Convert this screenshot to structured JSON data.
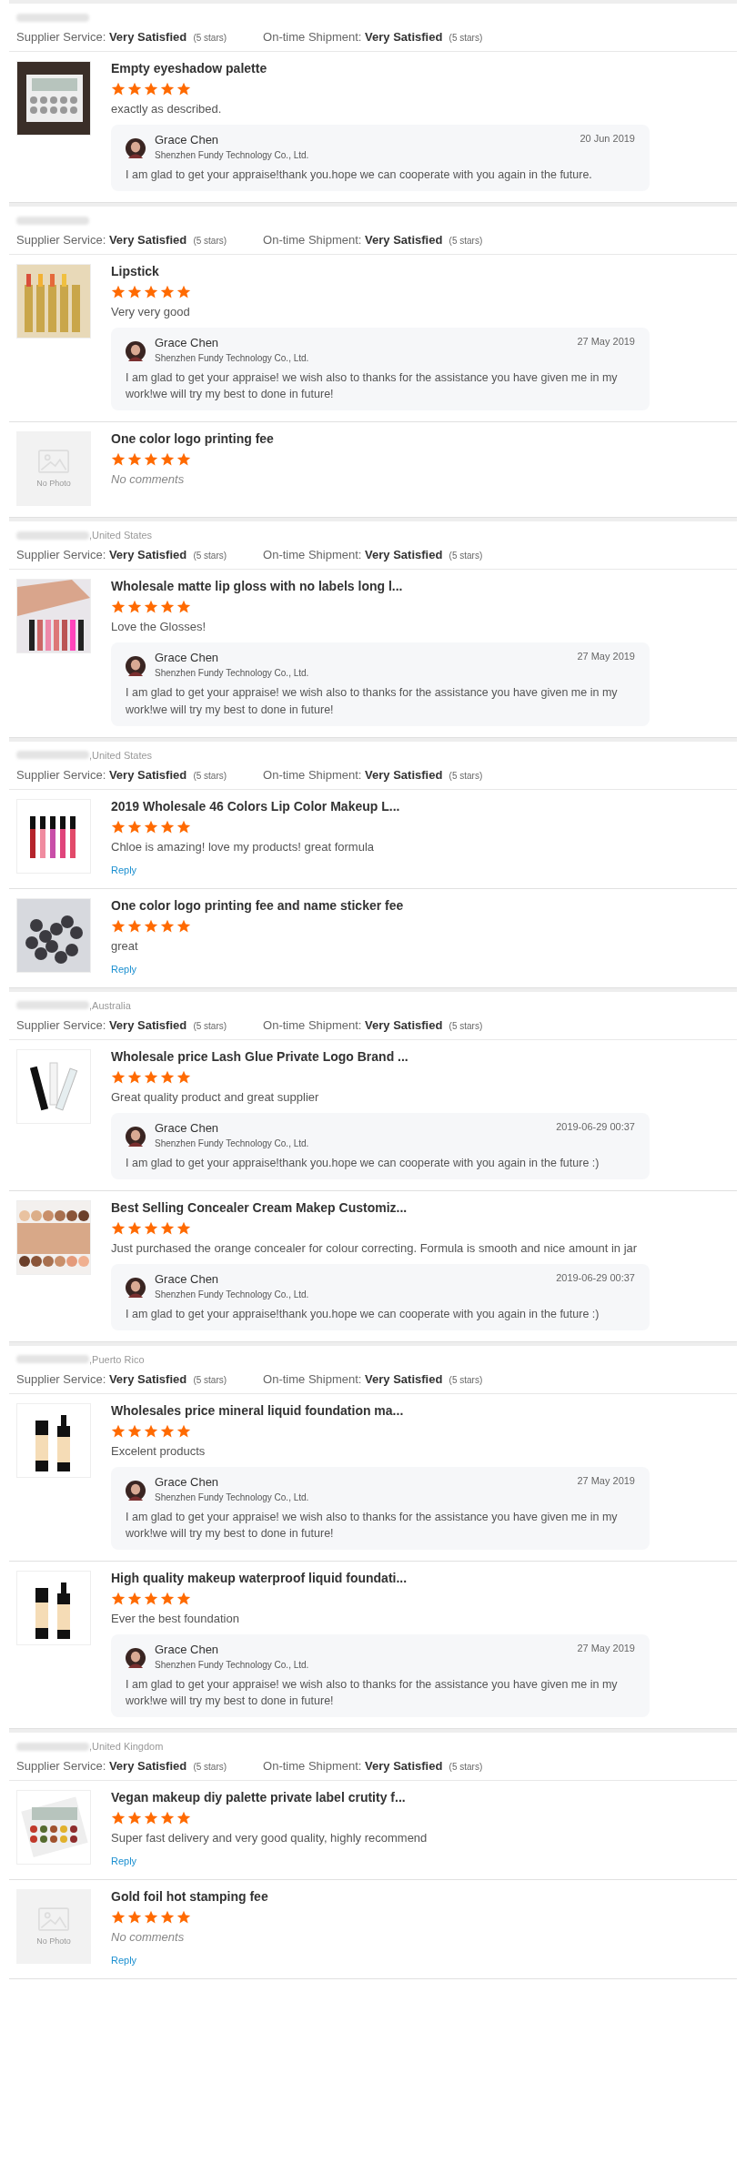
{
  "sections": [
    {
      "ratings": [
        {
          "label": "Supplier Service:",
          "value": "Very Satisfied",
          "note": "(5 stars)"
        },
        {
          "label": "On-time Shipment:",
          "value": "Very Satisfied",
          "note": "(5 stars)"
        }
      ],
      "items": [
        {
          "title": "Empty eyeshadow palette",
          "stars": 5,
          "comment": "exactly as described.",
          "comment_empty": false,
          "reply": {
            "name": "Grace Chen",
            "company": "Shenzhen Fundy Technology Co., Ltd.",
            "date": "20 Jun 2019",
            "text": "I am glad to get your appraise!thank you.hope we can cooperate with you again in the future."
          }
        }
      ]
    },
    {
      "ratings": [
        {
          "label": "Supplier Service:",
          "value": "Very Satisfied",
          "note": "(5 stars)"
        },
        {
          "label": "On-time Shipment:",
          "value": "Very Satisfied",
          "note": "(5 stars)"
        }
      ],
      "items": [
        {
          "title": "Lipstick",
          "stars": 5,
          "comment": "Very very good",
          "comment_empty": false,
          "reply": {
            "name": "Grace Chen",
            "company": "Shenzhen Fundy Technology Co., Ltd.",
            "date": "27 May 2019",
            "text": "I am glad to get your appraise! we wish also to thanks for the assistance you have given me in my work!we will try my best to done in future!"
          }
        },
        {
          "image": {
            "kind": "placeholder",
            "label": "No Photo"
          },
          "title": "One color logo printing fee",
          "stars": 5,
          "comment": "No comments",
          "comment_empty": true
        }
      ]
    },
    {
      "location": ",United States",
      "ratings": [
        {
          "label": "Supplier Service:",
          "value": "Very Satisfied",
          "note": "(5 stars)"
        },
        {
          "label": "On-time Shipment:",
          "value": "Very Satisfied",
          "note": "(5 stars)"
        }
      ],
      "items": [
        {
          "title": "Wholesale matte lip gloss with no labels long l...",
          "stars": 5,
          "comment": "Love the Glosses!",
          "comment_empty": false,
          "reply": {
            "name": "Grace Chen",
            "company": "Shenzhen Fundy Technology Co., Ltd.",
            "date": "27 May 2019",
            "text": "I am glad to get your appraise! we wish also to thanks for the assistance you have given me in my work!we will try my best to done in future!"
          }
        }
      ]
    },
    {
      "location": ",United States",
      "ratings": [
        {
          "label": "Supplier Service:",
          "value": "Very Satisfied",
          "note": "(5 stars)"
        },
        {
          "label": "On-time Shipment:",
          "value": "Very Satisfied",
          "note": "(5 stars)"
        }
      ],
      "items": [
        {
          "title": "2019 Wholesale 46 Colors Lip Color Makeup L...",
          "stars": 5,
          "comment": "Chloe is amazing! love my products! great formula",
          "comment_empty": false,
          "reply_link": "Reply"
        },
        {
          "title": "One color logo printing fee and name sticker fee",
          "stars": 5,
          "comment": "great",
          "comment_empty": false,
          "reply_link": "Reply"
        }
      ]
    },
    {
      "location": ",Australia",
      "ratings": [
        {
          "label": "Supplier Service:",
          "value": "Very Satisfied",
          "note": "(5 stars)"
        },
        {
          "label": "On-time Shipment:",
          "value": "Very Satisfied",
          "note": "(5 stars)"
        }
      ],
      "items": [
        {
          "title": "Wholesale price Lash Glue Private Logo Brand ...",
          "stars": 5,
          "comment": "Great quality product and great supplier",
          "comment_empty": false,
          "reply": {
            "name": "Grace Chen",
            "company": "Shenzhen Fundy Technology Co., Ltd.",
            "date": "2019-06-29 00:37",
            "text": "I am glad to get your appraise!thank you.hope we can cooperate with you again in the future :)"
          }
        },
        {
          "title": "Best Selling Concealer Cream Makep Customiz...",
          "stars": 5,
          "comment": "Just purchased the orange concealer for colour correcting. Formula is smooth and nice amount in jar",
          "comment_empty": false,
          "reply": {
            "name": "Grace Chen",
            "company": "Shenzhen Fundy Technology Co., Ltd.",
            "date": "2019-06-29 00:37",
            "text": "I am glad to get your appraise!thank you.hope we can cooperate with you again in the future :)"
          }
        }
      ]
    },
    {
      "location": ",Puerto Rico",
      "ratings": [
        {
          "label": "Supplier Service:",
          "value": "Very Satisfied",
          "note": "(5 stars)"
        },
        {
          "label": "On-time Shipment:",
          "value": "Very Satisfied",
          "note": "(5 stars)"
        }
      ],
      "items": [
        {
          "title": "Wholesales price mineral liquid foundation ma...",
          "stars": 5,
          "comment": "Excelent products",
          "comment_empty": false,
          "reply": {
            "name": "Grace Chen",
            "company": "Shenzhen Fundy Technology Co., Ltd.",
            "date": "27 May 2019",
            "text": "I am glad to get your appraise! we wish also to thanks for the assistance you have given me in my work!we will try my best to done in future!"
          }
        },
        {
          "title": "High quality makeup waterproof liquid foundati...",
          "stars": 5,
          "comment": "Ever the best foundation",
          "comment_empty": false,
          "reply": {
            "name": "Grace Chen",
            "company": "Shenzhen Fundy Technology Co., Ltd.",
            "date": "27 May 2019",
            "text": "I am glad to get your appraise! we wish also to thanks for the assistance you have given me in my work!we will try my best to done in future!"
          }
        }
      ]
    },
    {
      "location": ",United Kingdom",
      "ratings": [
        {
          "label": "Supplier Service:",
          "value": "Very Satisfied",
          "note": "(5 stars)"
        },
        {
          "label": "On-time Shipment:",
          "value": "Very Satisfied",
          "note": "(5 stars)"
        }
      ],
      "items": [
        {
          "title": "Vegan makeup diy palette private label crutity f...",
          "stars": 5,
          "comment": "Super fast delivery and very good quality, highly recommend",
          "comment_empty": false,
          "reply_link": "Reply"
        },
        {
          "image": {
            "kind": "placeholder",
            "label": "No Photo"
          },
          "title": "Gold foil hot stamping fee",
          "stars": 5,
          "comment": "No comments",
          "comment_empty": true,
          "reply_link": "Reply"
        }
      ]
    }
  ]
}
